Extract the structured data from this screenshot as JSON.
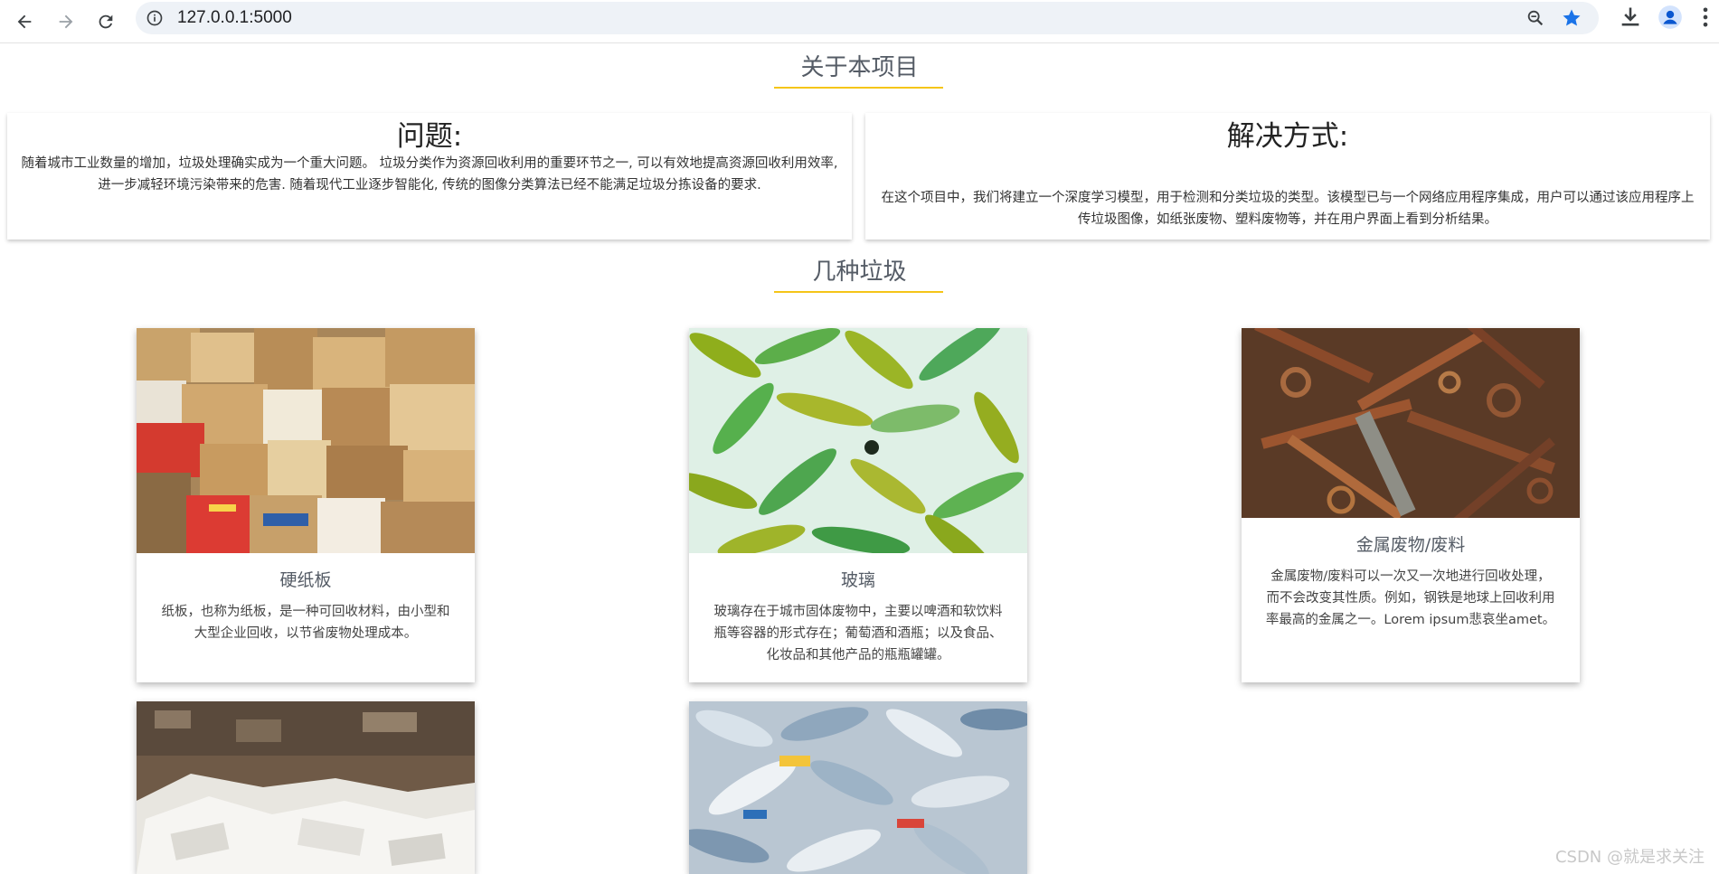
{
  "browser": {
    "url": "127.0.0.1:5000"
  },
  "about": {
    "title": "关于本项目",
    "problem": {
      "heading": "问题:",
      "line1": "随着城市工业数量的增加，垃圾处理确实成为一个重大问题。 垃圾分类作为资源回收利用的重要环节之一, 可以有效地提高资源回收利用效率,",
      "line2": "进一步减轻环境污染带来的危害. 随着现代工业逐步智能化, 传统的图像分类算法已经不能满足垃圾分拣设备的要求."
    },
    "solution": {
      "heading": "解决方式:",
      "line1": "在这个项目中，我们将建立一个深度学习模型，用于检测和分类垃圾的类型。该模型已与一个网络应用程序集成，用户可以通过该应用程序上",
      "line2": "传垃圾图像，如纸张废物、塑料废物等，并在用户界面上看到分析结果。"
    }
  },
  "types": {
    "title": "几种垃圾",
    "cards": [
      {
        "title": "硬纸板",
        "lines": [
          "纸板，也称为纸板，是一种可回收材料，由小型和",
          "大型企业回收，以节省废物处理成本。"
        ]
      },
      {
        "title": "玻璃",
        "lines": [
          "玻璃存在于城市固体废物中，主要以啤酒和软饮料",
          "瓶等容器的形式存在；葡萄酒和酒瓶；以及食品、",
          "化妆品和其他产品的瓶瓶罐罐。"
        ]
      },
      {
        "title": "金属废物/废料",
        "lines": [
          "金属废物/废料可以一次又一次地进行回收处理，",
          "而不会改变其性质。例如，钢铁是地球上回收利用",
          "率最高的金属之一。Lorem ipsum悲哀坐amet。"
        ]
      }
    ]
  },
  "watermark": "CSDN @就是求关注",
  "colors": {
    "accent_underline": "#f5c518",
    "star": "#1a73e8"
  }
}
